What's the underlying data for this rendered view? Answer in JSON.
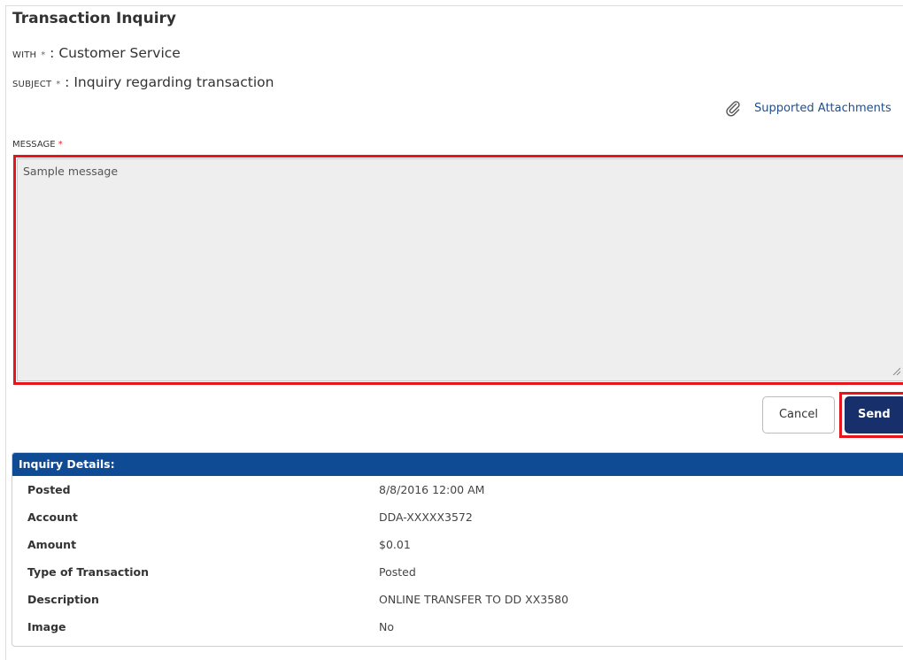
{
  "form": {
    "title": "Transaction Inquiry",
    "with_label": "WITH",
    "with_required": "*",
    "with_value": "Customer Service",
    "subject_label": "SUBJECT",
    "subject_required": "*",
    "subject_value": "Inquiry regarding transaction",
    "separator": ":",
    "attachments_link": "Supported Attachments",
    "attachments_icon": "paperclip-icon",
    "message_label": "MESSAGE",
    "message_required": "*",
    "message_value": "Sample message",
    "highlight_color": "#e8141b"
  },
  "actions": {
    "cancel_label": "Cancel",
    "send_label": "Send",
    "send_color": "#17306b"
  },
  "details": {
    "header": "Inquiry Details:",
    "header_color": "#0f4a95",
    "rows": [
      {
        "label": "Posted",
        "value": "8/8/2016 12:00 AM"
      },
      {
        "label": "Account",
        "value": "DDA-XXXXX3572"
      },
      {
        "label": "Amount",
        "value": "$0.01"
      },
      {
        "label": "Type of Transaction",
        "value": "Posted"
      },
      {
        "label": "Description",
        "value": "ONLINE TRANSFER TO DD XX3580"
      },
      {
        "label": "Image",
        "value": "No"
      }
    ]
  }
}
